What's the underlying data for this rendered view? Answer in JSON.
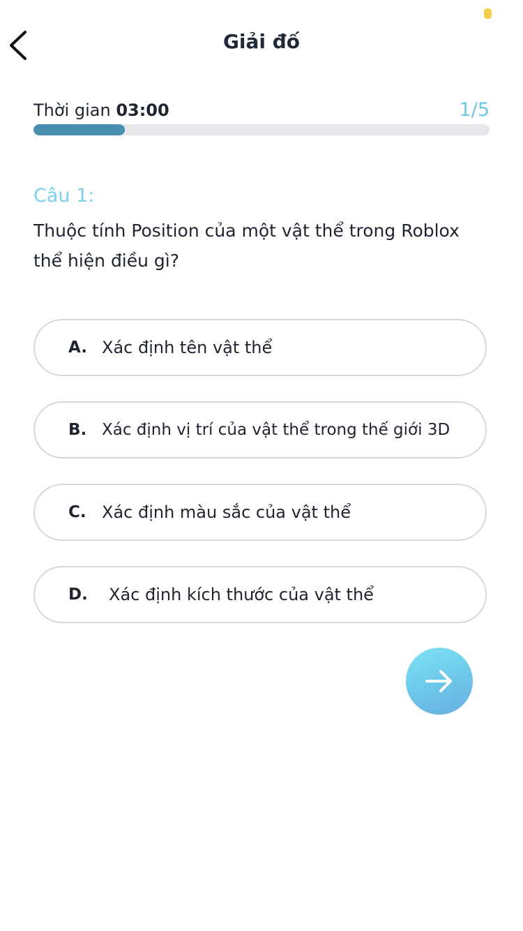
{
  "colors": {
    "status_dot": "#f4cf4d",
    "counter": "#6bc8e4",
    "question_number": "#7dd0eb",
    "progress_fill": "#4a8fb0"
  },
  "header": {
    "back_icon": "chevron-left-icon",
    "title": "Giải đố"
  },
  "timer": {
    "label": "Thời gian ",
    "value": "03:00",
    "counter": "1/5"
  },
  "progress": {
    "fraction": 0.2
  },
  "question": {
    "number": "Câu 1:",
    "text": "Thuộc tính Position của một vật thể trong Roblox thể hiện điều gì?"
  },
  "answers": [
    {
      "letter": "A.",
      "text": "Xác định tên vật thể"
    },
    {
      "letter": "B.",
      "text": "Xác định vị trí của vật thể trong thế giới 3D"
    },
    {
      "letter": "C.",
      "text": "Xác định màu sắc của vật thể"
    },
    {
      "letter": "D.",
      "text": "Xác định kích thước của vật thể"
    }
  ],
  "next_button": {
    "icon": "arrow-right-icon"
  }
}
